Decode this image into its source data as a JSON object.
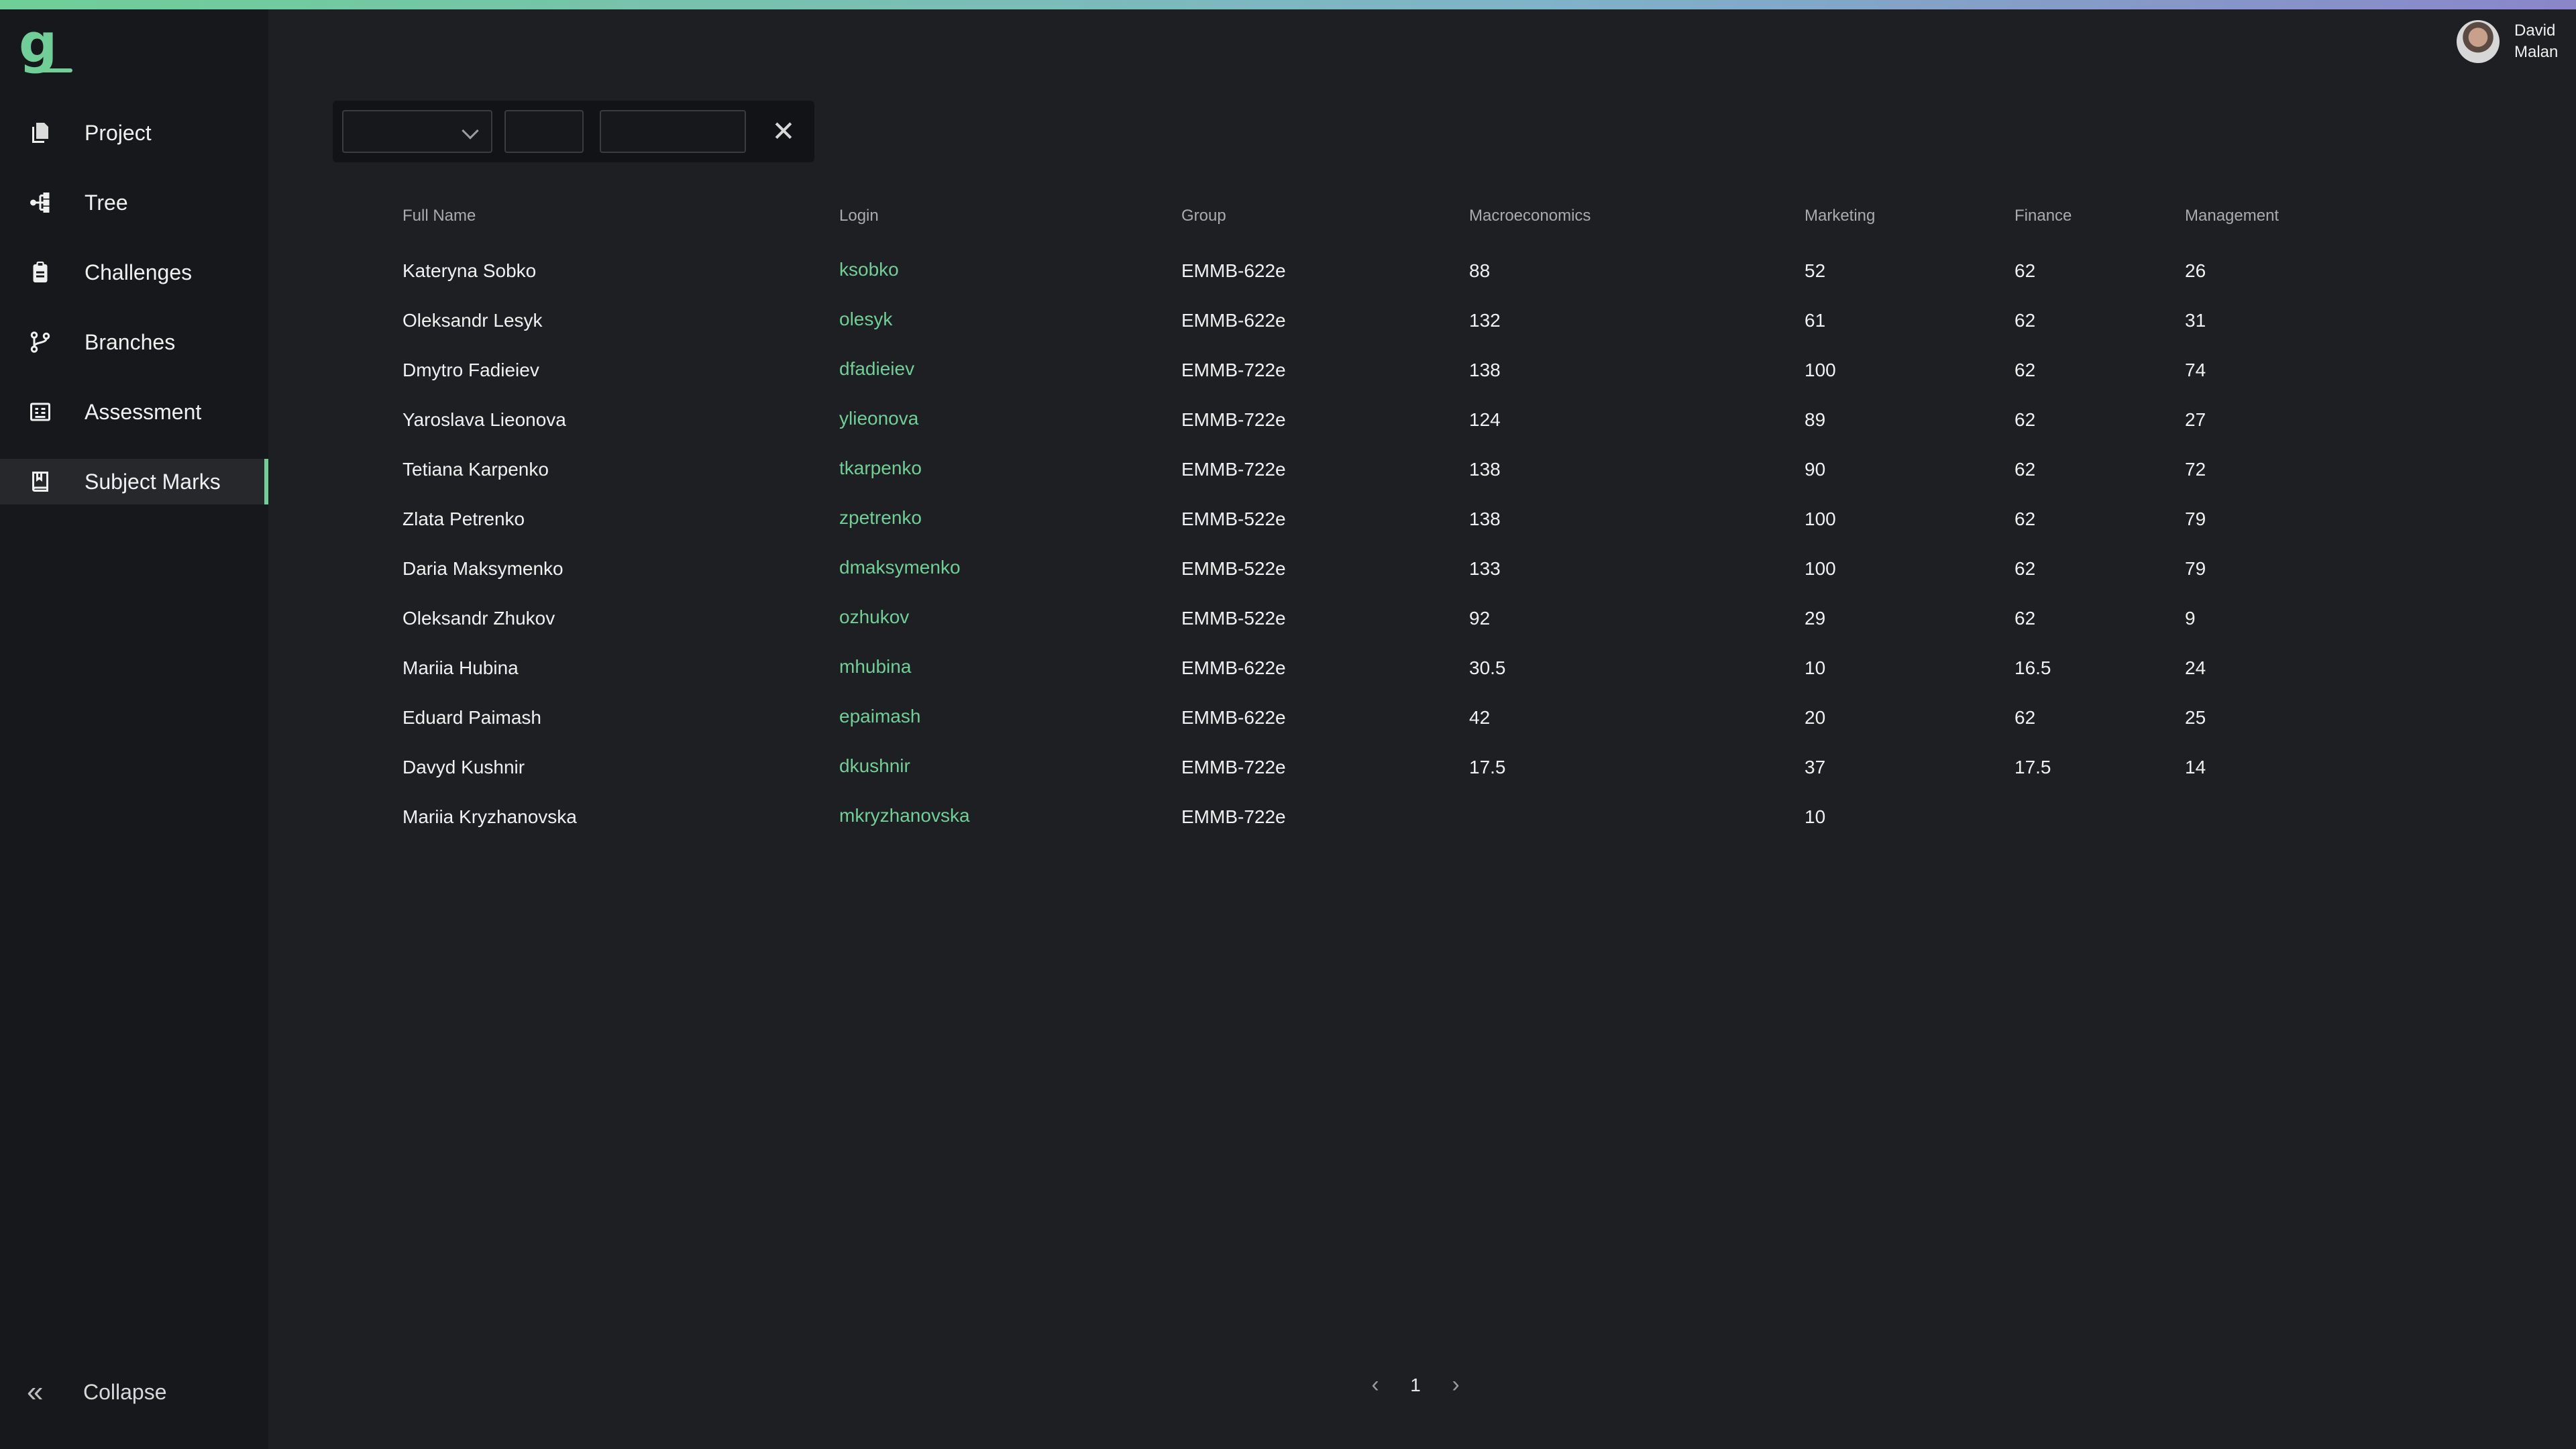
{
  "sidebar": {
    "logo_letter": "g",
    "items": [
      {
        "label": "Project",
        "icon": "files-icon"
      },
      {
        "label": "Tree",
        "icon": "tree-icon"
      },
      {
        "label": "Challenges",
        "icon": "clipboard-icon"
      },
      {
        "label": "Branches",
        "icon": "git-branch-icon"
      },
      {
        "label": "Assessment",
        "icon": "assessment-icon"
      },
      {
        "label": "Subject Marks",
        "icon": "book-icon",
        "active": true
      }
    ],
    "collapse_label": "Collapse"
  },
  "user": {
    "first": "David",
    "last": "Malan"
  },
  "table": {
    "headers": [
      "Full Name",
      "Login",
      "Group",
      "Macroeconomics",
      "Marketing",
      "Finance",
      "Management"
    ],
    "rows": [
      [
        "Kateryna Sobko",
        "ksobko",
        "EMMB-622e",
        "88",
        "52",
        "62",
        "26"
      ],
      [
        "Oleksandr Lesyk",
        "olesyk",
        "EMMB-622e",
        "132",
        "61",
        "62",
        "31"
      ],
      [
        "Dmytro Fadieiev",
        "dfadieiev",
        "EMMB-722e",
        "138",
        "100",
        "62",
        "74"
      ],
      [
        "Yaroslava Lieonova",
        "ylieonova",
        "EMMB-722e",
        "124",
        "89",
        "62",
        "27"
      ],
      [
        "Tetiana Karpenko",
        "tkarpenko",
        "EMMB-722e",
        "138",
        "90",
        "62",
        "72"
      ],
      [
        "Zlata Petrenko",
        "zpetrenko",
        "EMMB-522e",
        "138",
        "100",
        "62",
        "79"
      ],
      [
        "Daria Maksymenko",
        "dmaksymenko",
        "EMMB-522e",
        "133",
        "100",
        "62",
        "79"
      ],
      [
        "Oleksandr Zhukov",
        "ozhukov",
        "EMMB-522e",
        "92",
        "29",
        "62",
        "9"
      ],
      [
        "Mariia Hubina",
        "mhubina",
        "EMMB-622e",
        "30.5",
        "10",
        "16.5",
        "24"
      ],
      [
        "Eduard Paimash",
        "epaimash",
        "EMMB-622e",
        "42",
        "20",
        "62",
        "25"
      ],
      [
        "Davyd Kushnir",
        "dkushnir",
        "EMMB-722e",
        "17.5",
        "37",
        "17.5",
        "14"
      ],
      [
        "Mariia Kryzhanovska",
        "mkryzhanovska",
        "EMMB-722e",
        "",
        "10",
        "",
        ""
      ]
    ]
  },
  "pagination": {
    "current": "1"
  },
  "colors": {
    "accent": "#6fcf97",
    "background": "#1e1f22",
    "sidebar": "#17181b"
  }
}
